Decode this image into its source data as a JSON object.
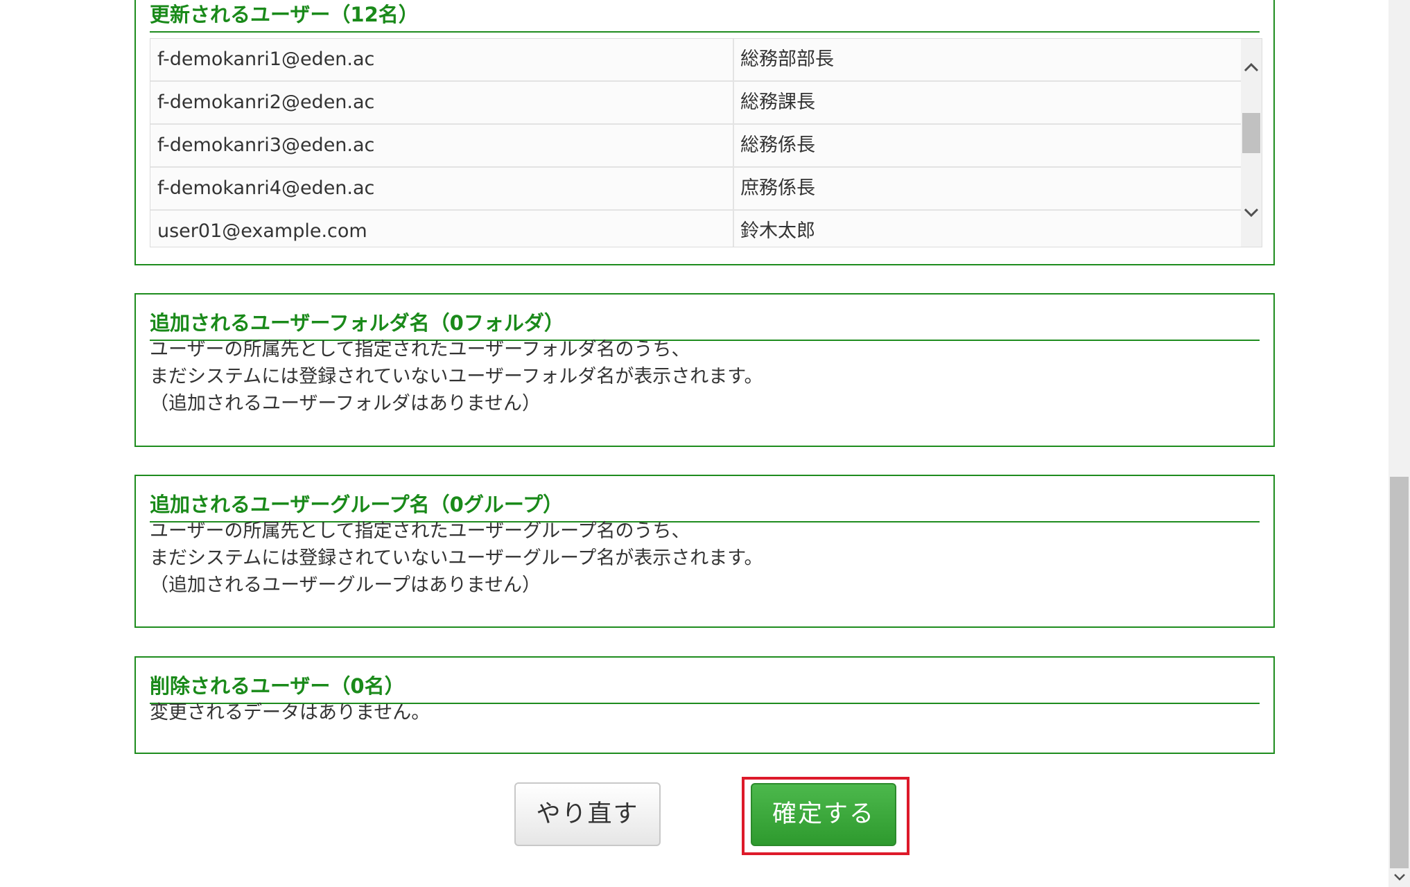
{
  "updated_users": {
    "title": "更新されるユーザー（12名）",
    "rows": [
      {
        "email": "f-demokanri1@eden.ac",
        "name": "総務部部長"
      },
      {
        "email": "f-demokanri2@eden.ac",
        "name": "総務課長"
      },
      {
        "email": "f-demokanri3@eden.ac",
        "name": "総務係長"
      },
      {
        "email": "f-demokanri4@eden.ac",
        "name": "庶務係長"
      },
      {
        "email": "user01@example.com",
        "name": "鈴木太郎"
      }
    ]
  },
  "added_folders": {
    "title": "追加されるユーザーフォルダ名（0フォルダ）",
    "lines": [
      "ユーザーの所属先として指定されたユーザーフォルダ名のうち、",
      "まだシステムには登録されていないユーザーフォルダ名が表示されます。",
      "（追加されるユーザーフォルダはありません）"
    ]
  },
  "added_groups": {
    "title": "追加されるユーザーグループ名（0グループ）",
    "lines": [
      "ユーザーの所属先として指定されたユーザーグループ名のうち、",
      "まだシステムには登録されていないユーザーグループ名が表示されます。",
      "（追加されるユーザーグループはありません）"
    ]
  },
  "deleted_users": {
    "title": "削除されるユーザー（0名）",
    "lines": [
      "変更されるデータはありません。"
    ]
  },
  "buttons": {
    "redo_label": "やり直す",
    "confirm_label": "確定する"
  },
  "icons": {
    "scroll_up": "chevron-up-icon",
    "scroll_down": "chevron-down-icon"
  },
  "colors": {
    "accent_green": "#1a8a1a",
    "confirm_button": "#3aa83a",
    "highlight_red": "#dd1a2a"
  }
}
